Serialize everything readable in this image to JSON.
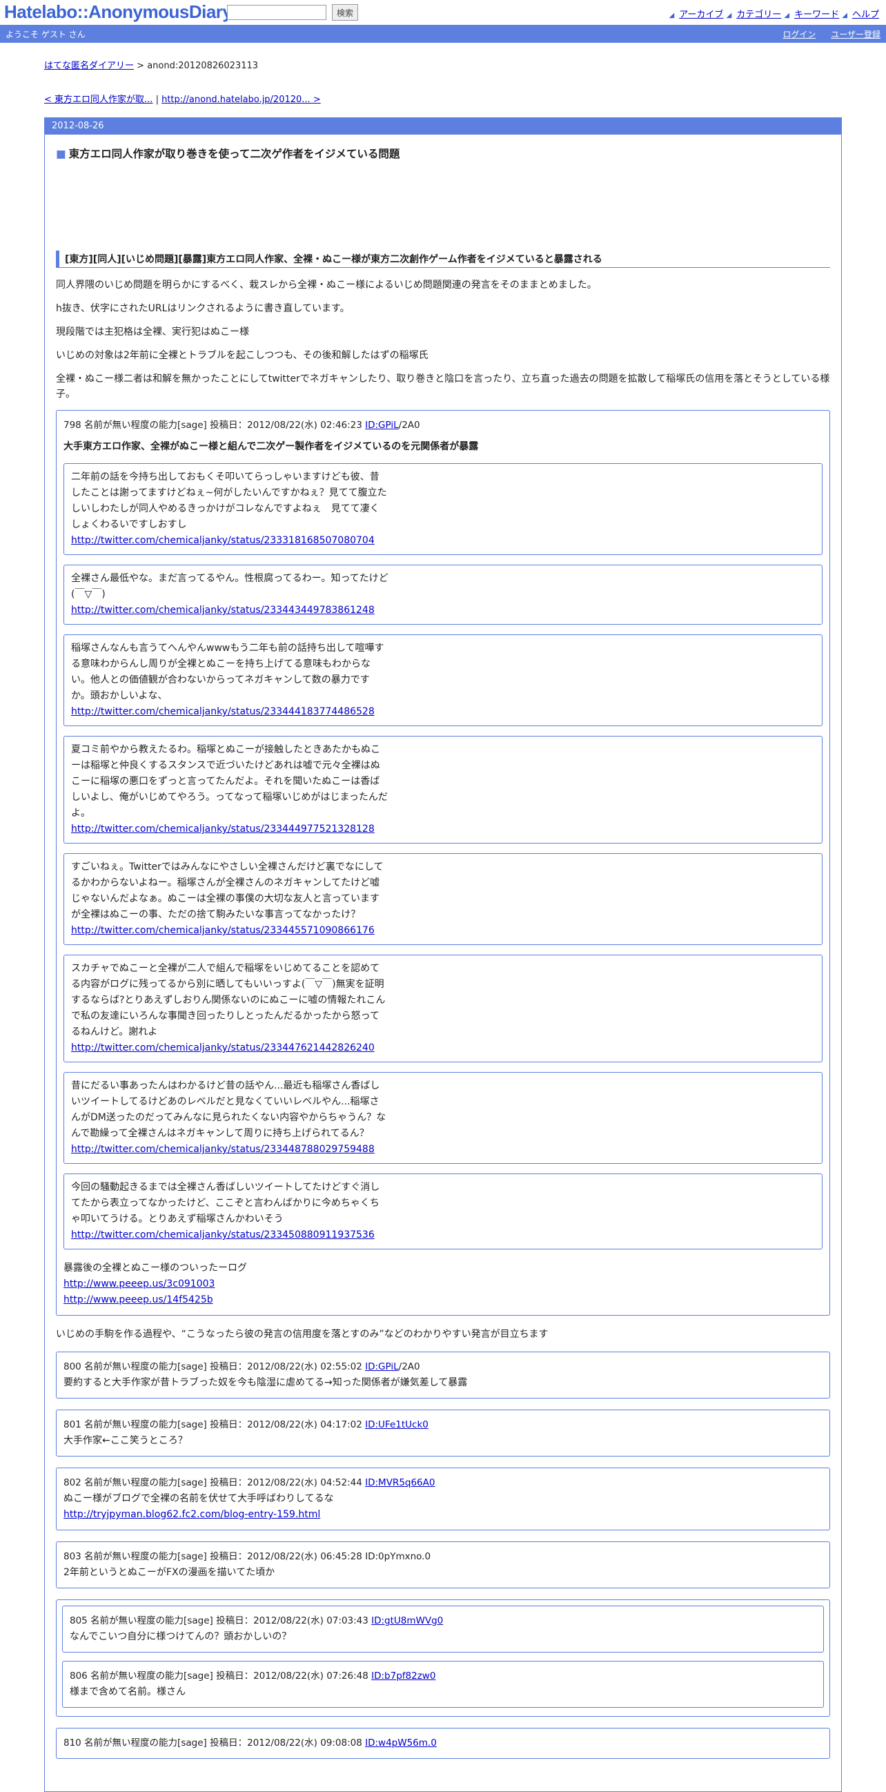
{
  "header": {
    "logo": "Hatelabo::AnonymousDiary",
    "search_value": "",
    "search_button": "検索",
    "links": [
      "アーカイブ",
      "カテゴリー",
      "キーワード",
      "ヘルプ"
    ]
  },
  "welcome_bar": {
    "text": "ようこそ ゲスト さん",
    "login": "ログイン",
    "register": "ユーザー登録"
  },
  "breadcrumb": {
    "home": "はてな匿名ダイアリー",
    "sep": " > ",
    "current": "anond:20120826023113"
  },
  "pager": {
    "prev": "< 東方エロ同人作家が取...",
    "sep": " | ",
    "next": "http://anond.hatelabo.jp/20120... >"
  },
  "day": {
    "date": "2012-08-26",
    "title": "東方エロ同人作家が取り巻きを使って二次ゲ作者をイジメている問題",
    "section_heading": "[東方][同人][いじめ問題][暴露]東方エロ同人作家、全裸・ぬこー様が東方二次創作ゲーム作者をイジメていると暴露される",
    "intro": [
      "同人界隈のいじめ問題を明らかにするべく、栽スレから全裸・ぬこー様によるいじめ問題関連の発言をそのままとめました。",
      "h抜き、伏字にされたURLはリンクされるように書き直しています。",
      "現段階では主犯格は全裸、実行犯はぬこー様",
      "いじめの対象は2年前に全裸とトラブルを起こしつつも、その後和解したはずの稲塚氏",
      "全裸・ぬこー様二者は和解を無かったことにしてtwitterでネガキャンしたり、取り巻きと陰口を言ったり、立ち直った過去の問題を拡散して稲塚氏の信用を落とそうとしている様子。"
    ],
    "main_post": {
      "header": "798 名前が無い程度の能力[sage] 投稿日：2012/08/22(水) 02:46:23 ",
      "id_link": "ID:GPiL",
      "id_tail": "/2A0",
      "lead": "大手東方エロ作家、全裸がぬこー様と組んで二次ゲー製作者をイジメているのを元関係者が暴露",
      "tweets": [
        {
          "text": "二年前の話を今持ち出しておもくそ叩いてらっしゃいますけども彼、昔したことは謝ってますけどねぇ~何がしたいんですかねぇ？見てて腹立たしいしわたしが同人やめるきっかけがコレなんですよねぇ　見てて凄くしょくわるいですしおすし",
          "url": "http://twitter.com/chemicaljanky/status/233318168507080704"
        },
        {
          "text": "全裸さん最低やな。まだ言ってるやん。性根腐ってるわー。知ってたけど(￣▽￣)",
          "url": "http://twitter.com/chemicaljanky/status/233443449783861248"
        },
        {
          "text": "稲塚さんなんも言うてへんやんwwwもう二年も前の話持ち出して喧嘩する意味わからんし周りが全裸とぬこーを持ち上げてる意味もわからない。他人との価値観が合わないからってネガキャンして数の暴力ですか。頭おかしいよな、",
          "url": "http://twitter.com/chemicaljanky/status/233444183774486528"
        },
        {
          "text": "夏コミ前やから教えたるわ。稲塚とぬこーが接触したときあたかもぬこーは稲塚と仲良くするスタンスで近づいたけどあれは嘘で元々全裸はぬこーに稲塚の悪口をずっと言ってたんだよ。それを聞いたぬこーは香ばしいよし、俺がいじめてやろう。ってなって稲塚いじめがはじまったんだよ。",
          "url": "http://twitter.com/chemicaljanky/status/233444977521328128"
        },
        {
          "text": "すごいねぇ。Twitterではみんなにやさしい全裸さんだけど裏でなにしてるかわからないよねー。稲塚さんが全裸さんのネガキャンしてたけど嘘じゃないんだよなぁ。ぬこーは全裸の事僕の大切な友人と言っていますが全裸はぬこーの事、ただの捨て駒みたいな事言ってなかったけ？",
          "url": "http://twitter.com/chemicaljanky/status/233445571090866176"
        },
        {
          "text": "スカチャでぬこーと全裸が二人で組んで稲塚をいじめてることを認めてる内容がログに残ってるから別に晒してもいいっすよ(￣▽￣)無実を証明するならば?とりあえずしおりん関係ないのにぬこーに嘘の情報たれこんで私の友達にいろんな事聞き回ったりしとったんだるかったから怒ってるねんけど。謝れよ",
          "url": "http://twitter.com/chemicaljanky/status/233447621442826240"
        },
        {
          "text": "昔にだるい事あったんはわかるけど昔の話やん...最近も稲塚さん香ばしいツイートしてるけどあのレベルだと見なくていいレベルやん...稲塚さんがDM送ったのだってみんなに見られたくない内容やからちゃうん？なんで勘繰って全裸さんはネガキャンして周りに持ち上げられてるん？",
          "url": "http://twitter.com/chemicaljanky/status/233448788029759488"
        },
        {
          "text": "今回の騒動起きるまでは全裸さん香ばしいツイートしてたけどすぐ消してたから表立ってなかったけど、ここぞと言わんばかりに今めちゃくちゃ叩いてうける。とりあえず稲塚さんかわいそう",
          "url": "http://twitter.com/chemicaljanky/status/233450880911937536"
        }
      ],
      "log_title": "暴露後の全裸とぬこー様のついったーログ",
      "log_links": [
        "http://www.peeep.us/3c091003",
        "http://www.peeep.us/14f5425b"
      ]
    },
    "after_text": "いじめの手駒を作る過程や、“こうなったら彼の発言の信用度を落とすのみ”などのわかりやすい発言が目立ちます",
    "replies": [
      {
        "header": "800 名前が無い程度の能力[sage] 投稿日：2012/08/22(水) 02:55:02 ",
        "id_link": "ID:GPiL",
        "id_tail": "/2A0",
        "body": "要約すると大手作家が昔トラブった奴を今も陰湿に虐めてる→知った関係者が嫌気差して暴露"
      },
      {
        "header": "801 名前が無い程度の能力[sage] 投稿日：2012/08/22(水) 04:17:02 ",
        "id_link": "ID:UFe1tUck0",
        "id_tail": "",
        "body": "大手作家←ここ笑うところ？"
      },
      {
        "header": "802 名前が無い程度の能力[sage] 投稿日：2012/08/22(水) 04:52:44 ",
        "id_link": "ID:MVR5q66A0",
        "id_tail": "",
        "body": "ぬこー様がブログで全裸の名前を伏せて大手呼ばわりしてるな",
        "link": "http://tryjpyman.blog62.fc2.com/blog-entry-159.html"
      },
      {
        "header": "803 名前が無い程度の能力[sage] 投稿日：2012/08/22(水) 06:45:28 ID:0pYmxno.0",
        "id_link": "",
        "id_tail": "",
        "body": "2年前というとぬこーがFXの漫画を描いてた頃か"
      }
    ],
    "nested_replies": [
      {
        "header": "805 名前が無い程度の能力[sage] 投稿日：2012/08/22(水) 07:03:43 ",
        "id_link": "ID:gtU8mWVg0",
        "body": "なんでこいつ自分に様つけてんの？頭おかしいの？"
      },
      {
        "header": "806 名前が無い程度の能力[sage] 投稿日：2012/08/22(水) 07:26:48 ",
        "id_link": "ID:b7pf82zw0",
        "body": "様まで含めて名前。様さん"
      }
    ],
    "last_reply": {
      "header": "810 名前が無い程度の能力[sage] 投稿日：2012/08/22(水) 09:08:08 ",
      "id_link": "ID:w4pW56m.0"
    }
  }
}
